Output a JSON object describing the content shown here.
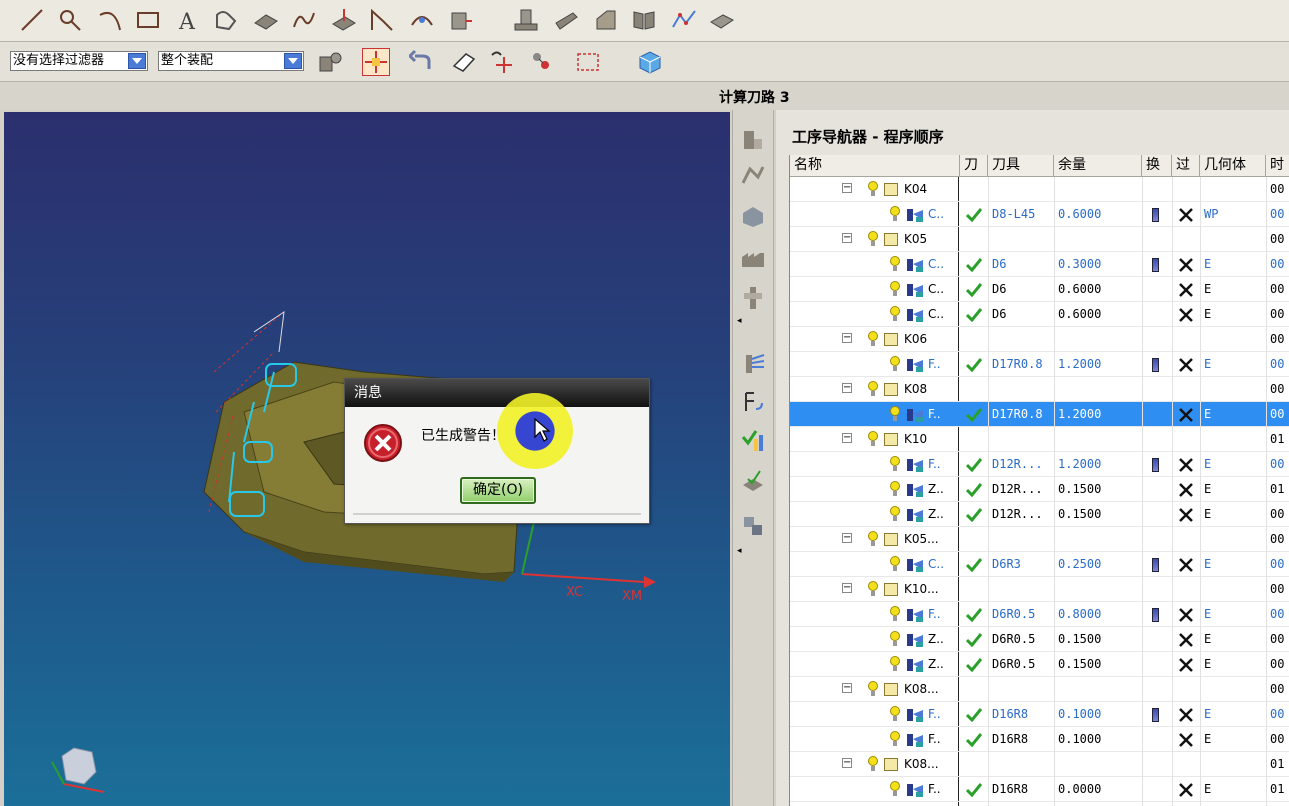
{
  "toolbar2": {
    "filter_value": "没有选择过滤器",
    "assembly_value": "整个装配"
  },
  "status": {
    "text": "计算刀路 3"
  },
  "navigator": {
    "title": "工序导航器 - 程序顺序",
    "headers": [
      "名称",
      "刀",
      "刀具",
      "余量",
      "换",
      "过",
      "几何体",
      "时"
    ],
    "rows": [
      {
        "type": "group",
        "name": "K04",
        "time": "00"
      },
      {
        "type": "op",
        "name": "C..",
        "check": true,
        "tool": "D8-L45",
        "stock": "0.6000",
        "swap": true,
        "excl": true,
        "geom": "WP",
        "time": "00",
        "blue": true
      },
      {
        "type": "group",
        "name": "K05",
        "time": "00"
      },
      {
        "type": "op",
        "name": "C..",
        "check": true,
        "tool": "D6",
        "stock": "0.3000",
        "swap": true,
        "excl": true,
        "geom": "E",
        "time": "00",
        "blue": true
      },
      {
        "type": "op",
        "name": "C..",
        "check": true,
        "tool": "D6",
        "stock": "0.6000",
        "swap": false,
        "excl": true,
        "geom": "E",
        "time": "00",
        "blue": false
      },
      {
        "type": "op",
        "name": "C..",
        "check": true,
        "tool": "D6",
        "stock": "0.6000",
        "swap": false,
        "excl": true,
        "geom": "E",
        "time": "00",
        "blue": false
      },
      {
        "type": "group",
        "name": "K06",
        "time": "00"
      },
      {
        "type": "op",
        "name": "F..",
        "check": true,
        "tool": "D17R0.8",
        "stock": "1.2000",
        "swap": true,
        "excl": true,
        "geom": "E",
        "time": "00",
        "blue": true
      },
      {
        "type": "group",
        "name": "K08",
        "time": "00"
      },
      {
        "type": "op",
        "name": "F..",
        "check": true,
        "tool": "D17R0.8",
        "stock": "1.2000",
        "swap": false,
        "excl": true,
        "geom": "E",
        "time": "00",
        "blue": false,
        "selected": true
      },
      {
        "type": "group",
        "name": "K10",
        "time": "01"
      },
      {
        "type": "op",
        "name": "F..",
        "check": true,
        "tool": "D12R...",
        "stock": "1.2000",
        "swap": true,
        "excl": true,
        "geom": "E",
        "time": "00",
        "blue": true
      },
      {
        "type": "op",
        "name": "Z..",
        "check": true,
        "tool": "D12R...",
        "stock": "0.1500",
        "swap": false,
        "excl": true,
        "geom": "E",
        "time": "01",
        "blue": false
      },
      {
        "type": "op",
        "name": "Z..",
        "check": true,
        "tool": "D12R...",
        "stock": "0.1500",
        "swap": false,
        "excl": true,
        "geom": "E",
        "time": "00",
        "blue": false
      },
      {
        "type": "group",
        "name": "K05...",
        "time": "00"
      },
      {
        "type": "op",
        "name": "C..",
        "check": true,
        "tool": "D6R3",
        "stock": "0.2500",
        "swap": true,
        "excl": true,
        "geom": "E",
        "time": "00",
        "blue": true
      },
      {
        "type": "group",
        "name": "K10...",
        "time": "00"
      },
      {
        "type": "op",
        "name": "F..",
        "check": true,
        "tool": "D6R0.5",
        "stock": "0.8000",
        "swap": true,
        "excl": true,
        "geom": "E",
        "time": "00",
        "blue": true
      },
      {
        "type": "op",
        "name": "Z..",
        "check": true,
        "tool": "D6R0.5",
        "stock": "0.1500",
        "swap": false,
        "excl": true,
        "geom": "E",
        "time": "00",
        "blue": false
      },
      {
        "type": "op",
        "name": "Z..",
        "check": true,
        "tool": "D6R0.5",
        "stock": "0.1500",
        "swap": false,
        "excl": true,
        "geom": "E",
        "time": "00",
        "blue": false
      },
      {
        "type": "group",
        "name": "K08...",
        "time": "00"
      },
      {
        "type": "op",
        "name": "F..",
        "check": true,
        "tool": "D16R8",
        "stock": "0.1000",
        "swap": true,
        "excl": true,
        "geom": "E",
        "time": "00",
        "blue": true
      },
      {
        "type": "op",
        "name": "F..",
        "check": true,
        "tool": "D16R8",
        "stock": "0.1000",
        "swap": false,
        "excl": true,
        "geom": "E",
        "time": "00",
        "blue": false
      },
      {
        "type": "group",
        "name": "K08...",
        "time": "01"
      },
      {
        "type": "op",
        "name": "F..",
        "check": true,
        "tool": "D16R8",
        "stock": "0.0000",
        "swap": false,
        "excl": true,
        "geom": "E",
        "time": "01",
        "blue": false
      }
    ]
  },
  "viewport": {
    "axis_xc": "XC",
    "axis_xm": "XM"
  },
  "dialog": {
    "title": "消息",
    "message": "已生成警告！",
    "ok_label": "确定(O)"
  },
  "colors": {
    "selection": "#2f8ef2",
    "link_blue": "#2a6bc8",
    "check_green": "#2aa02a"
  }
}
